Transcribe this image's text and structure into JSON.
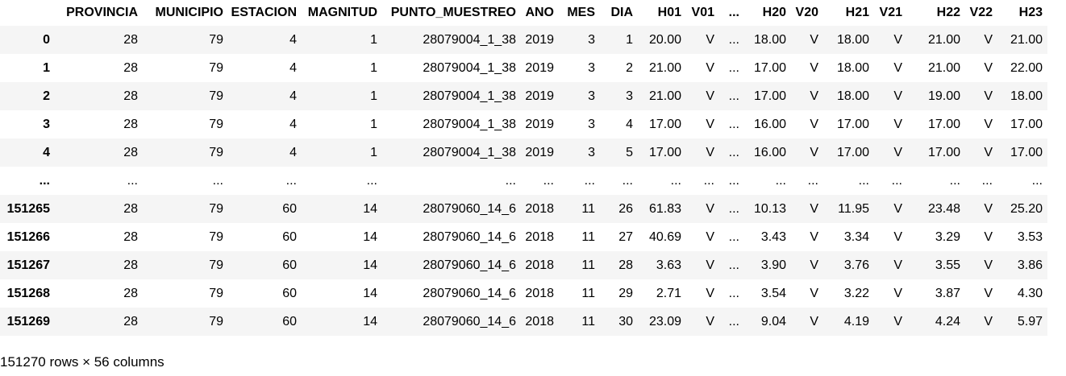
{
  "table": {
    "columns": [
      "",
      "PROVINCIA",
      "MUNICIPIO",
      "ESTACION",
      "MAGNITUD",
      "PUNTO_MUESTREO",
      "ANO",
      "MES",
      "DIA",
      "H01",
      "V01",
      "...",
      "H20",
      "V20",
      "H21",
      "V21",
      "H22",
      "V22",
      "H23"
    ],
    "rows": [
      [
        "0",
        "28",
        "79",
        "4",
        "1",
        "28079004_1_38",
        "2019",
        "3",
        "1",
        "20.00",
        "V",
        "...",
        "18.00",
        "V",
        "18.00",
        "V",
        "21.00",
        "V",
        "21.00"
      ],
      [
        "1",
        "28",
        "79",
        "4",
        "1",
        "28079004_1_38",
        "2019",
        "3",
        "2",
        "21.00",
        "V",
        "...",
        "17.00",
        "V",
        "18.00",
        "V",
        "21.00",
        "V",
        "22.00"
      ],
      [
        "2",
        "28",
        "79",
        "4",
        "1",
        "28079004_1_38",
        "2019",
        "3",
        "3",
        "21.00",
        "V",
        "...",
        "17.00",
        "V",
        "18.00",
        "V",
        "19.00",
        "V",
        "18.00"
      ],
      [
        "3",
        "28",
        "79",
        "4",
        "1",
        "28079004_1_38",
        "2019",
        "3",
        "4",
        "17.00",
        "V",
        "...",
        "16.00",
        "V",
        "17.00",
        "V",
        "17.00",
        "V",
        "17.00"
      ],
      [
        "4",
        "28",
        "79",
        "4",
        "1",
        "28079004_1_38",
        "2019",
        "3",
        "5",
        "17.00",
        "V",
        "...",
        "16.00",
        "V",
        "17.00",
        "V",
        "17.00",
        "V",
        "17.00"
      ],
      [
        "...",
        "...",
        "...",
        "...",
        "...",
        "...",
        "...",
        "...",
        "...",
        "...",
        "...",
        "...",
        "...",
        "...",
        "...",
        "...",
        "...",
        "...",
        "..."
      ],
      [
        "151265",
        "28",
        "79",
        "60",
        "14",
        "28079060_14_6",
        "2018",
        "11",
        "26",
        "61.83",
        "V",
        "...",
        "10.13",
        "V",
        "11.95",
        "V",
        "23.48",
        "V",
        "25.20"
      ],
      [
        "151266",
        "28",
        "79",
        "60",
        "14",
        "28079060_14_6",
        "2018",
        "11",
        "27",
        "40.69",
        "V",
        "...",
        "3.43",
        "V",
        "3.34",
        "V",
        "3.29",
        "V",
        "3.53"
      ],
      [
        "151267",
        "28",
        "79",
        "60",
        "14",
        "28079060_14_6",
        "2018",
        "11",
        "28",
        "3.63",
        "V",
        "...",
        "3.90",
        "V",
        "3.76",
        "V",
        "3.55",
        "V",
        "3.86"
      ],
      [
        "151268",
        "28",
        "79",
        "60",
        "14",
        "28079060_14_6",
        "2018",
        "11",
        "29",
        "2.71",
        "V",
        "...",
        "3.54",
        "V",
        "3.22",
        "V",
        "3.87",
        "V",
        "4.30"
      ],
      [
        "151269",
        "28",
        "79",
        "60",
        "14",
        "28079060_14_6",
        "2018",
        "11",
        "30",
        "23.09",
        "V",
        "...",
        "9.04",
        "V",
        "4.19",
        "V",
        "4.24",
        "V",
        "5.97"
      ]
    ]
  },
  "footer": {
    "shape": "151270 rows × 56 columns"
  },
  "colors": {
    "stripe": "#f5f5f5",
    "background": "#ffffff",
    "text": "#000000"
  }
}
